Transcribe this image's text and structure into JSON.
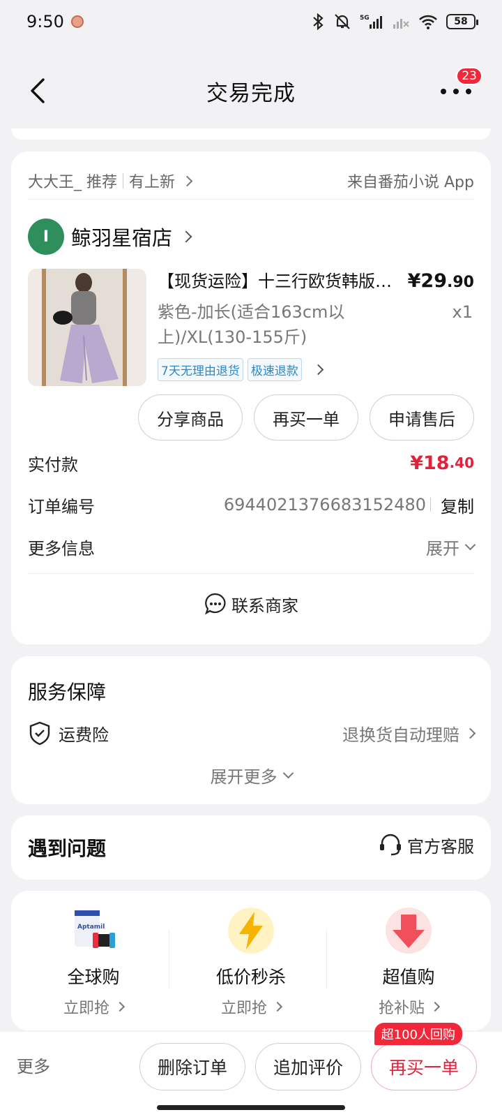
{
  "status": {
    "time": "9:50",
    "network": "5G",
    "battery": "58"
  },
  "nav": {
    "title": "交易完成",
    "badge": "23"
  },
  "recommend": {
    "user": "大大王_ 推荐",
    "new": "有上新",
    "source": "来自番茄小说 App"
  },
  "shop": {
    "logo_letter": "I",
    "name": "鲸羽星宿店"
  },
  "product": {
    "title": "【现货运险】十三行欧货韩版紫色阔腿裤",
    "price_int": "¥29",
    "price_dec": ".90",
    "spec": "紫色-加长(适合163cm以上)/XL(130-155斤)",
    "qty": "x1",
    "tags": [
      "7天无理由退货",
      "极速退款"
    ]
  },
  "actions": {
    "share": "分享商品",
    "rebuy": "再买一单",
    "aftersale": "申请售后"
  },
  "info": {
    "paid_label": "实付款",
    "paid_int": "¥18",
    "paid_dec": ".40",
    "order_label": "订单编号",
    "order_no": "6944021376683152480",
    "copy": "复制",
    "more_label": "更多信息",
    "expand": "展开"
  },
  "contact": "联系商家",
  "service": {
    "title": "服务保障",
    "item": "运费险",
    "item_desc": "退换货自动理赔",
    "more": "展开更多"
  },
  "problem": {
    "title": "遇到问题",
    "cs": "官方客服"
  },
  "promos": [
    {
      "name": "全球购",
      "sub": "立即抢"
    },
    {
      "name": "低价秒杀",
      "sub": "立即抢"
    },
    {
      "name": "超值购",
      "sub": "抢补贴"
    }
  ],
  "bottom": {
    "more": "更多",
    "delete": "删除订单",
    "review": "追加评价",
    "rebuy": "再买一单",
    "rebuy_tag": "超100人回购"
  },
  "colors": {
    "accent": "#e4213a",
    "shop_logo": "#2e8f5c",
    "tag_blue": "#2a88c9"
  }
}
